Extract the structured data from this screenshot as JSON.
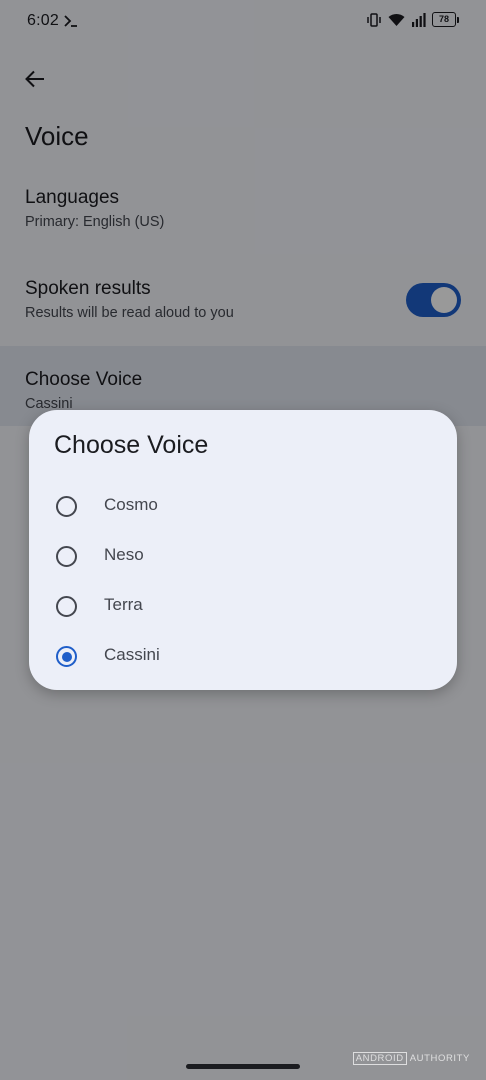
{
  "status_bar": {
    "time": "6:02",
    "battery": "78",
    "icons": [
      "terminal-icon",
      "vibrate-icon",
      "wifi-icon",
      "signal-icon",
      "battery-icon"
    ]
  },
  "header": {
    "back_icon": "arrow-back-icon",
    "title": "Voice"
  },
  "settings": {
    "languages": {
      "title": "Languages",
      "subtitle": "Primary: English (US)"
    },
    "spoken_results": {
      "title": "Spoken results",
      "subtitle": "Results will be read aloud to you",
      "enabled": true
    },
    "choose_voice": {
      "title": "Choose Voice",
      "subtitle": "Cassini"
    }
  },
  "dialog": {
    "title": "Choose Voice",
    "options": [
      {
        "label": "Cosmo",
        "selected": false
      },
      {
        "label": "Neso",
        "selected": false
      },
      {
        "label": "Terra",
        "selected": false
      },
      {
        "label": "Cassini",
        "selected": true
      }
    ]
  },
  "watermark": {
    "brand_boxed": "ANDROID",
    "brand_rest": "AUTHORITY"
  },
  "colors": {
    "accent": "#1f5ec9",
    "toggle_track": "#1f5ec9",
    "background": "#f3f5fb",
    "dialog_bg": "#eceff8"
  }
}
